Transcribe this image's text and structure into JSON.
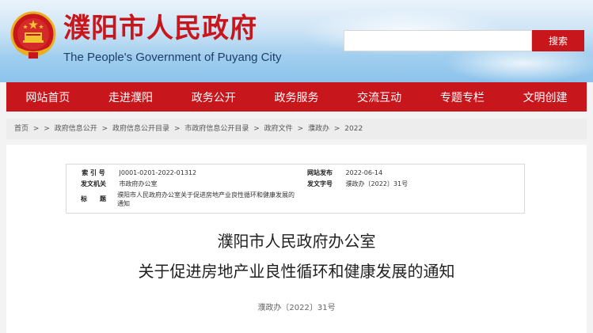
{
  "header": {
    "title": "濮阳市人民政府",
    "subtitle": "The People's Government of Puyang City",
    "search_placeholder": "",
    "search_label": "搜索"
  },
  "nav": {
    "items": [
      {
        "label": "网站首页"
      },
      {
        "label": "走进濮阳"
      },
      {
        "label": "政务公开"
      },
      {
        "label": "政务服务"
      },
      {
        "label": "交流互动"
      },
      {
        "label": "专题专栏"
      },
      {
        "label": "文明创建"
      }
    ]
  },
  "breadcrumb": {
    "items": [
      "首页",
      ">",
      ">",
      "政府信息公开",
      ">",
      "政府信息公开目录",
      ">",
      "市政府信息公开目录",
      ">",
      "政府文件",
      ">",
      "濮政办",
      ">",
      "2022"
    ]
  },
  "meta": {
    "index_label": "索 引 号",
    "index_value": "J0001-0201-2022-01312",
    "date_label": "网站发布",
    "date_value": "2022-06-14",
    "org_label": "发文机关",
    "org_value": "市政府办公室",
    "docno_label": "发文字号",
    "docno_value": "濮政办〔2022〕31号",
    "title_label": "标　　题",
    "title_value": "濮阳市人民政府办公室关于促进房地产业良性循环和健康发展的通知"
  },
  "document": {
    "title_line1": "濮阳市人民政府办公室",
    "title_line2": "关于促进房地产业良性循环和健康发展的通知",
    "number": "濮政办〔2022〕31号"
  },
  "colors": {
    "brand_red": "#c8161d",
    "subtitle_blue": "#1e3f66"
  }
}
